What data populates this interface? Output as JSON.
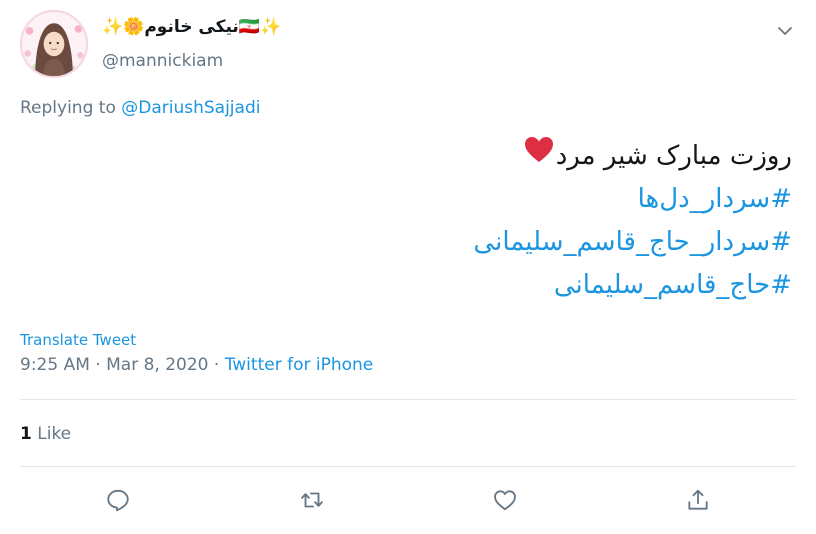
{
  "tweet": {
    "author": {
      "display_name": "نیکی خانوم",
      "emoji_left": "✨",
      "emoji_flower": "🌼",
      "emoji_flag": "🇮🇷",
      "emoji_right": "✨",
      "handle": "@mannickiam"
    },
    "replying_to_label": "Replying to",
    "replying_to_mention": "@DariushSajjadi",
    "body_line1": "روزت مبارک شیر مرد",
    "hashtags": [
      "#سردار_دل‌ها",
      "#سردار_حاج_قاسم_سلیمانی",
      "#حاج_قاسم_سلیمانی"
    ],
    "translate_label": "Translate Tweet",
    "time": "9:25 AM",
    "date": "Mar 8, 2020",
    "separator": "·",
    "source": "Twitter for iPhone",
    "likes_count": "1",
    "likes_label": "Like"
  },
  "icons": {
    "more": "chevron-down-icon",
    "reply": "reply-icon",
    "retweet": "retweet-icon",
    "like": "heart-icon",
    "share": "share-icon"
  },
  "colors": {
    "link": "#1b95e0",
    "secondary": "#657786",
    "text": "#14171a",
    "divider": "#e1e8ed",
    "heart": "#e0245e"
  }
}
